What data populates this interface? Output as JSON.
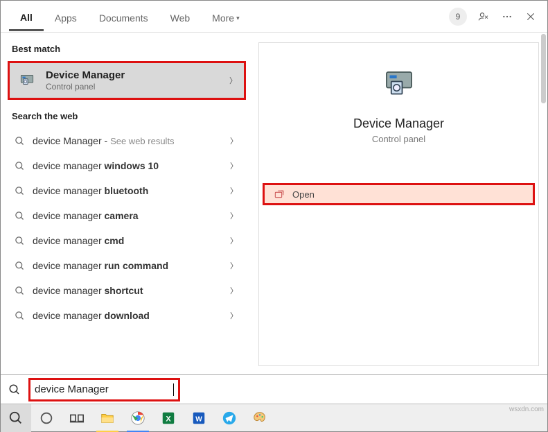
{
  "tabs": {
    "all": "All",
    "apps": "Apps",
    "documents": "Documents",
    "web": "Web",
    "more": "More"
  },
  "top": {
    "badge": "9"
  },
  "sections": {
    "best_match": "Best match",
    "search_web": "Search the web"
  },
  "best": {
    "title": "Device Manager",
    "sub": "Control panel"
  },
  "web_items": [
    {
      "prefix": "device Manager",
      "bold": "",
      "suffix_grey": "See web results"
    },
    {
      "prefix": "device manager ",
      "bold": "windows 10",
      "suffix_grey": ""
    },
    {
      "prefix": "device manager ",
      "bold": "bluetooth",
      "suffix_grey": ""
    },
    {
      "prefix": "device manager ",
      "bold": "camera",
      "suffix_grey": ""
    },
    {
      "prefix": "device manager ",
      "bold": "cmd",
      "suffix_grey": ""
    },
    {
      "prefix": "device manager ",
      "bold": "run command",
      "suffix_grey": ""
    },
    {
      "prefix": "device manager ",
      "bold": "shortcut",
      "suffix_grey": ""
    },
    {
      "prefix": "device manager ",
      "bold": "download",
      "suffix_grey": ""
    }
  ],
  "preview": {
    "title": "Device Manager",
    "sub": "Control panel",
    "open": "Open"
  },
  "search": {
    "value": "device Manager"
  },
  "watermark": "wsxdn.com"
}
